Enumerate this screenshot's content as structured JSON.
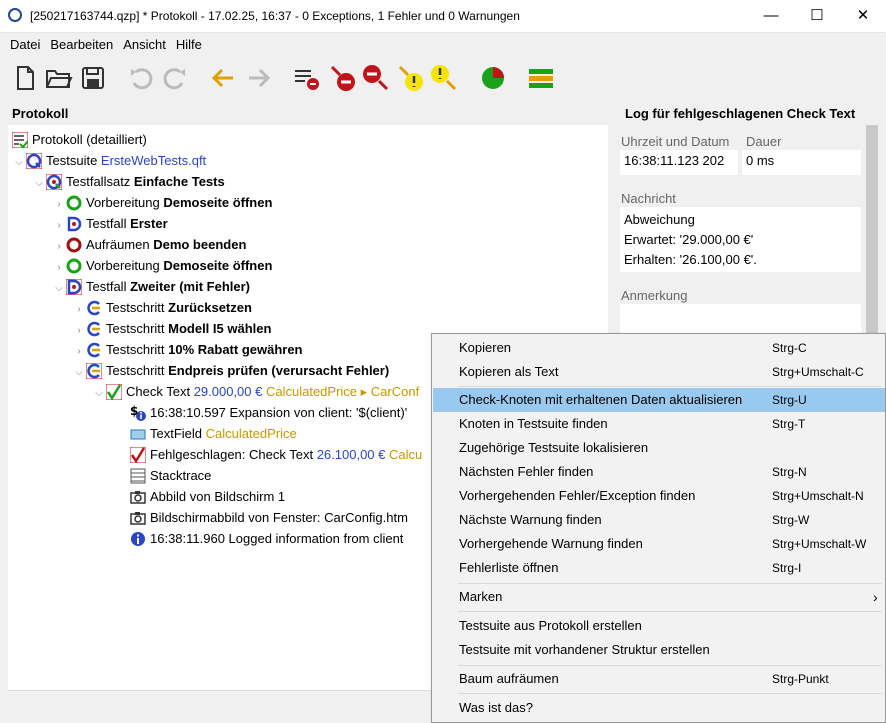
{
  "window": {
    "title": "[250217163744.qzp] * Protokoll - 17.02.25, 16:37 - 0 Exceptions, 1 Fehler und 0 Warnungen",
    "controls": [
      "—",
      "☐",
      "✕"
    ]
  },
  "menubar": {
    "items": [
      "Datei",
      "Bearbeiten",
      "Ansicht",
      "Hilfe"
    ]
  },
  "toolbar": {
    "icons": [
      "new-file-icon",
      "open-folder-icon",
      "save-icon",
      "undo-icon",
      "redo-icon",
      "back-arrow-icon",
      "forward-arrow-icon",
      "collapse-errors-icon",
      "prev-error-icon",
      "next-error-icon",
      "prev-warning-icon",
      "next-warning-icon",
      "pie-chart-icon",
      "bar-summary-icon"
    ]
  },
  "left_panel": {
    "title": "Protokoll"
  },
  "tree": {
    "rows": [
      {
        "prefix": "Protokoll (detailliert)",
        "bold": "",
        "extra": "",
        "extra2": ""
      },
      {
        "prefix": "Testsuite ",
        "bold": "",
        "extra": "ErsteWebTests.qft",
        "extra2": ""
      },
      {
        "prefix": "Testfallsatz ",
        "bold": "Einfache Tests",
        "extra": "",
        "extra2": ""
      },
      {
        "prefix": "Vorbereitung ",
        "bold": "Demoseite öffnen",
        "extra": "",
        "extra2": ""
      },
      {
        "prefix": "Testfall ",
        "bold": "Erster",
        "extra": "",
        "extra2": ""
      },
      {
        "prefix": "Aufräumen ",
        "bold": "Demo beenden",
        "extra": "",
        "extra2": ""
      },
      {
        "prefix": "Vorbereitung ",
        "bold": "Demoseite öffnen",
        "extra": "",
        "extra2": ""
      },
      {
        "prefix": "Testfall ",
        "bold": "Zweiter (mit Fehler)",
        "extra": "",
        "extra2": ""
      },
      {
        "prefix": "Testschritt ",
        "bold": "Zurücksetzen",
        "extra": "",
        "extra2": ""
      },
      {
        "prefix": "Testschritt ",
        "bold": "Modell I5 wählen",
        "extra": "",
        "extra2": ""
      },
      {
        "prefix": "Testschritt ",
        "bold": "10% Rabatt gewähren",
        "extra": "",
        "extra2": ""
      },
      {
        "prefix": "Testschritt ",
        "bold": "Endpreis prüfen (verursacht Fehler)",
        "extra": "",
        "extra2": ""
      },
      {
        "prefix": "Check Text ",
        "bold": "",
        "extra": "29.000,00 €",
        "extra2": " CalculatedPrice ▸ CarConf"
      },
      {
        "prefix": "16:38:10.597 Expansion von client: '$(client)'",
        "bold": "",
        "extra": "",
        "extra2": ""
      },
      {
        "prefix": "TextField ",
        "bold": "",
        "extra": "",
        "extra2": "CalculatedPrice"
      },
      {
        "prefix": "Fehlgeschlagen: Check Text ",
        "bold": "",
        "extra": "26.100,00 €",
        "extra2": " Calcu"
      },
      {
        "prefix": "Stacktrace",
        "bold": "",
        "extra": "",
        "extra2": ""
      },
      {
        "prefix": "Abbild von Bildschirm 1",
        "bold": "",
        "extra": "",
        "extra2": ""
      },
      {
        "prefix": "Bildschirmabbild von Fenster: CarConfig.htm",
        "bold": "",
        "extra": "",
        "extra2": ""
      },
      {
        "prefix": "16:38:11.960 Logged information from client",
        "bold": "",
        "extra": "",
        "extra2": ""
      }
    ]
  },
  "right_panel": {
    "title": "Log für fehlgeschlagenen Check Text",
    "time_label": "Uhrzeit und Datum",
    "duration_label": "Dauer",
    "time_value": "16:38:11.123  202",
    "duration_value": "0 ms",
    "message_label": "Nachricht",
    "message_lines": [
      "Abweichung",
      "Erwartet: '29.000,00 €'",
      "Erhalten: '26.100,00 €'."
    ],
    "note_label": "Anmerkung"
  },
  "context_menu": {
    "items": [
      {
        "label": "Kopieren",
        "shortcut": "Strg-C"
      },
      {
        "label": "Kopieren als Text",
        "shortcut": "Strg+Umschalt-C"
      },
      {
        "label": "Check-Knoten mit erhaltenen Daten aktualisieren",
        "shortcut": "Strg-U"
      },
      {
        "label": "Knoten in Testsuite finden",
        "shortcut": "Strg-T"
      },
      {
        "label": "Zugehörige Testsuite lokalisieren",
        "shortcut": ""
      },
      {
        "label": "Nächsten Fehler finden",
        "shortcut": "Strg-N"
      },
      {
        "label": "Vorhergehenden Fehler/Exception finden",
        "shortcut": "Strg+Umschalt-N"
      },
      {
        "label": "Nächste Warnung finden",
        "shortcut": "Strg-W"
      },
      {
        "label": "Vorhergehende Warnung finden",
        "shortcut": "Strg+Umschalt-W"
      },
      {
        "label": "Fehlerliste öffnen",
        "shortcut": "Strg-I"
      },
      {
        "label": "Marken",
        "shortcut": ""
      },
      {
        "label": "Testsuite aus Protokoll erstellen",
        "shortcut": ""
      },
      {
        "label": "Testsuite mit vorhandener Struktur erstellen",
        "shortcut": ""
      },
      {
        "label": "Baum aufräumen",
        "shortcut": "Strg-Punkt"
      },
      {
        "label": "Was ist das?",
        "shortcut": ""
      }
    ],
    "submenu_arrow": "›"
  },
  "colors": {
    "highlight": "#99c9ef",
    "link": "#2b46c2",
    "gold": "#c99700",
    "error_red": "#c0141a",
    "ok_green": "#1aa31a"
  }
}
